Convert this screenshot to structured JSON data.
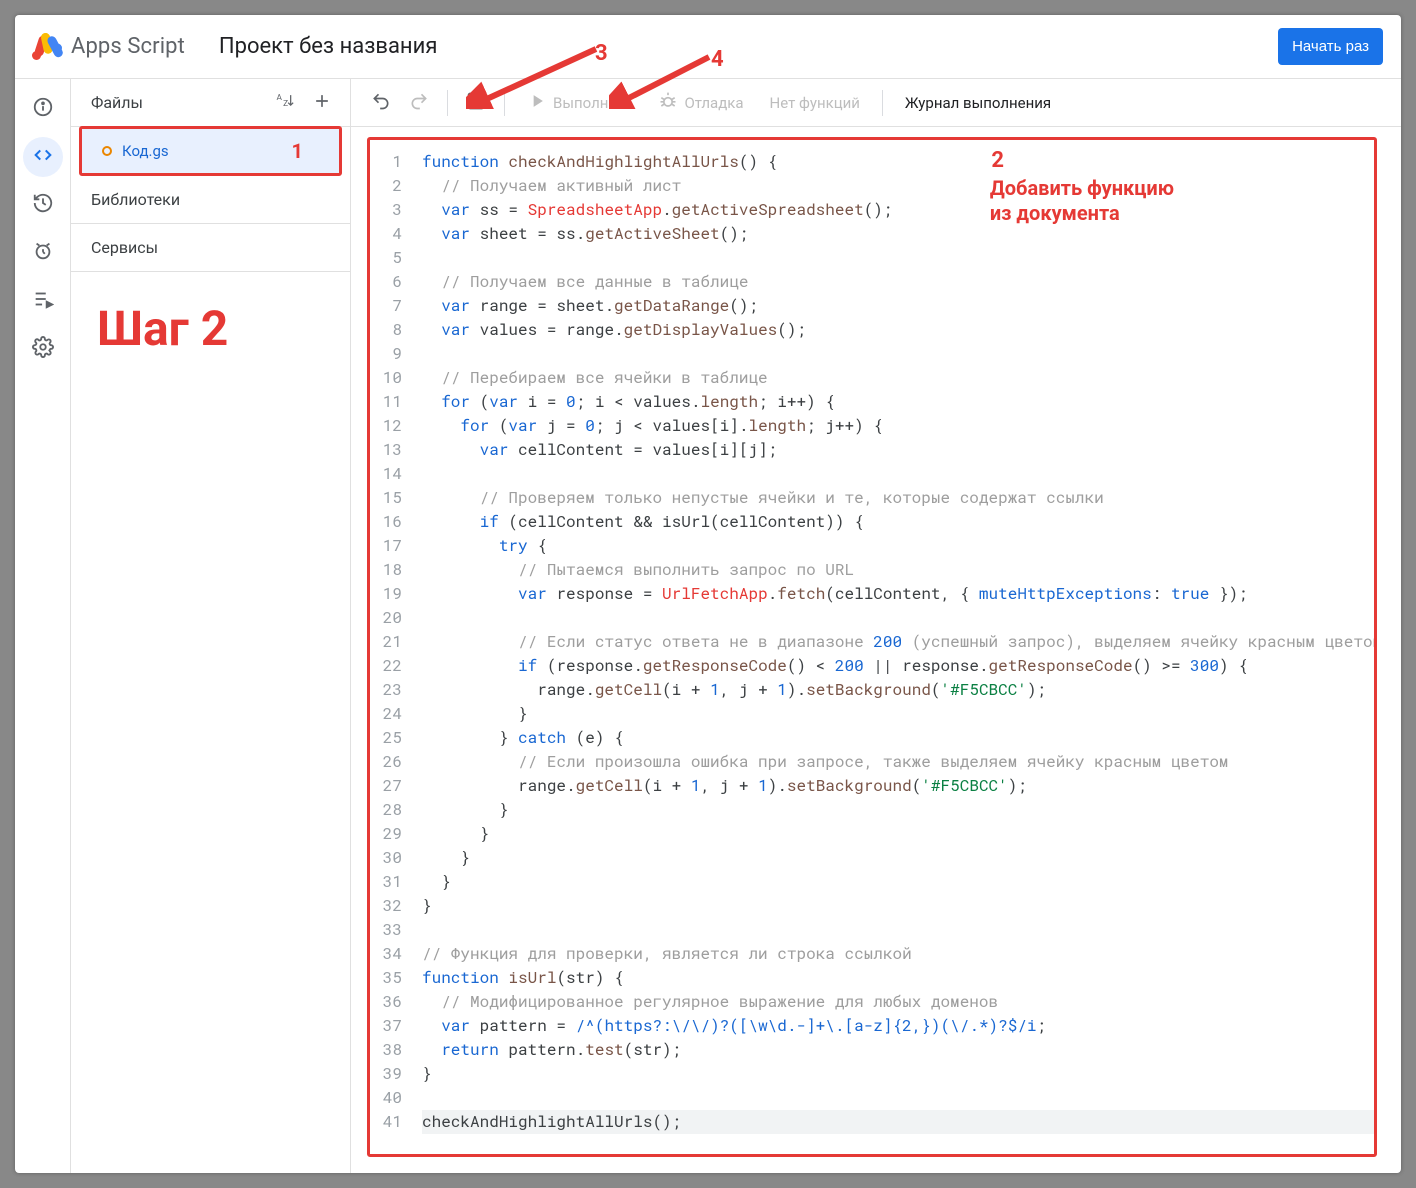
{
  "header": {
    "brand": "Apps Script",
    "project_title": "Проект без названия",
    "start_btn": "Начать раз"
  },
  "rail": {
    "info_icon": "info-icon",
    "editor_icon": "code-icon",
    "history_icon": "history-icon",
    "triggers_icon": "clock-icon",
    "exec_icon": "list-play-icon",
    "settings_icon": "gear-icon"
  },
  "sidebar": {
    "files_label": "Файлы",
    "sort_icon": "sort-az-icon",
    "file_name": "Код.gs",
    "libs_label": "Библиотеки",
    "services_label": "Сервисы"
  },
  "toolbar": {
    "undo": "undo",
    "redo": "redo",
    "save": "save",
    "run": "Выполнить",
    "debug": "Отладка",
    "nofunc": "Нет функций",
    "log": "Журнал выполнения"
  },
  "annotations": {
    "step": "Шаг 2",
    "m1": "1",
    "m2": "2",
    "m3": "3",
    "m4": "4",
    "addfn_l1": "Добавить функцию",
    "addfn_l2": "из документа"
  },
  "code": {
    "line_count": 41,
    "lines": [
      "function checkAndHighlightAllUrls() {",
      "  // Получаем активный лист",
      "  var ss = SpreadsheetApp.getActiveSpreadsheet();",
      "  var sheet = ss.getActiveSheet();",
      "",
      "  // Получаем все данные в таблице",
      "  var range = sheet.getDataRange();",
      "  var values = range.getDisplayValues();",
      "",
      "  // Перебираем все ячейки в таблице",
      "  for (var i = 0; i < values.length; i++) {",
      "    for (var j = 0; j < values[i].length; j++) {",
      "      var cellContent = values[i][j];",
      "",
      "      // Проверяем только непустые ячейки и те, которые содержат ссылки",
      "      if (cellContent && isUrl(cellContent)) {",
      "        try {",
      "          // Пытаемся выполнить запрос по URL",
      "          var response = UrlFetchApp.fetch(cellContent, { muteHttpExceptions: true });",
      "",
      "          // Если статус ответа не в диапазоне 200 (успешный запрос), выделяем ячейку красным цветом",
      "          if (response.getResponseCode() < 200 || response.getResponseCode() >= 300) {",
      "            range.getCell(i + 1, j + 1).setBackground('#F5CBCC');",
      "          }",
      "        } catch (e) {",
      "          // Если произошла ошибка при запросе, также выделяем ячейку красным цветом",
      "          range.getCell(i + 1, j + 1).setBackground('#F5CBCC');",
      "        }",
      "      }",
      "    }",
      "  }",
      "}",
      "",
      "// Функция для проверки, является ли строка ссылкой",
      "function isUrl(str) {",
      "  // Модифицированное регулярное выражение для любых доменов",
      "  var pattern = /^(https?:\\/\\/)?([\\w\\d.-]+\\.[a-z]{2,})(\\/.*)?$/i;",
      "  return pattern.test(str);",
      "}",
      "",
      "checkAndHighlightAllUrls();"
    ]
  }
}
